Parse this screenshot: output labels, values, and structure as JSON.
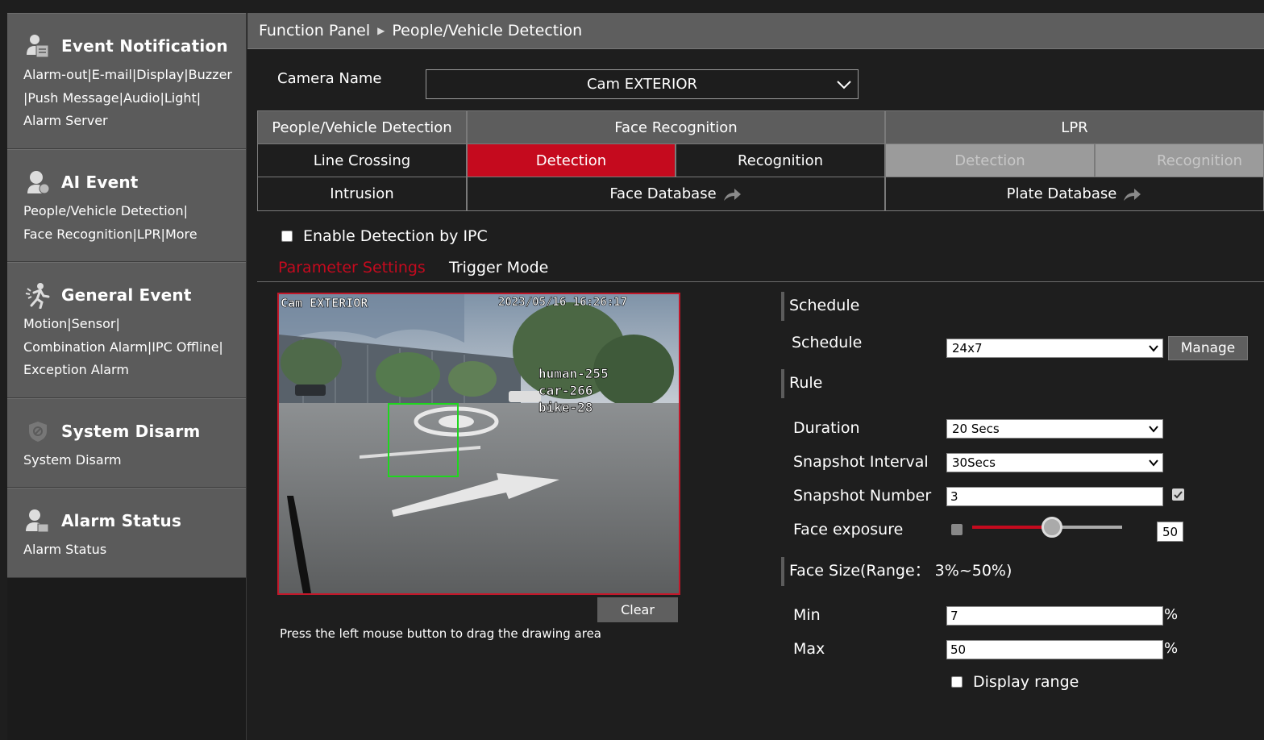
{
  "sidebar": {
    "sections": [
      {
        "title": "Event Notification",
        "desc": [
          "Alarm-out|E-mail|Display|Buzzer",
          "|Push Message|Audio|Light|",
          "Alarm Server"
        ],
        "icon": "notification-icon"
      },
      {
        "title": "AI Event",
        "desc": [
          "People/Vehicle Detection|",
          "Face Recognition|LPR|More"
        ],
        "icon": "ai-person-icon"
      },
      {
        "title": "General Event",
        "desc": [
          "Motion|Sensor|",
          "Combination Alarm|IPC Offline|",
          "Exception Alarm"
        ],
        "icon": "running-person-icon"
      },
      {
        "title": "System Disarm",
        "desc": [
          "System Disarm"
        ],
        "icon": "shield-icon"
      },
      {
        "title": "Alarm Status",
        "desc": [
          "Alarm Status"
        ],
        "icon": "alarm-person-icon"
      }
    ]
  },
  "breadcrumb": {
    "root": "Function Panel",
    "current": "People/Vehicle Detection"
  },
  "camera": {
    "label": "Camera Name",
    "value": "Cam EXTERIOR"
  },
  "tabs": {
    "pvd": "People/Vehicle Detection",
    "face": "Face Recognition",
    "lpr": "LPR",
    "line_crossing": "Line Crossing",
    "face_detection": "Detection",
    "face_recognition": "Recognition",
    "lpr_detection": "Detection",
    "lpr_recognition": "Recognition",
    "intrusion": "Intrusion",
    "face_database": "Face Database",
    "plate_database": "Plate Database"
  },
  "enable_label": "Enable Detection by IPC",
  "subtabs": {
    "parameter": "Parameter Settings",
    "trigger": "Trigger Mode"
  },
  "video": {
    "osd_name": "Cam EXTERIOR",
    "osd_time": "2023/05/16 16:26:17",
    "counts": [
      "human-255",
      "car-266",
      "bike-28"
    ]
  },
  "clear_label": "Clear",
  "hint": "Press the left mouse button to drag the drawing area",
  "schedule": {
    "section": "Schedule",
    "label": "Schedule",
    "value": "24x7",
    "manage": "Manage"
  },
  "rule": {
    "section": "Rule",
    "duration_label": "Duration",
    "duration_value": "20 Secs",
    "snap_interval_label": "Snapshot Interval",
    "snap_interval_value": "30Secs",
    "snap_number_label": "Snapshot Number",
    "snap_number_value": "3",
    "face_exposure_label": "Face exposure",
    "face_exposure_value": "50"
  },
  "face_size": {
    "section": "Face Size(Range： 3%~50%)",
    "min_label": "Min",
    "min_value": "7",
    "max_label": "Max",
    "max_value": "50",
    "pct": "%",
    "display_range": "Display range"
  },
  "colors": {
    "accent": "#c50a1e",
    "panel": "#5d5d5d",
    "bg": "#1e1e1e"
  }
}
